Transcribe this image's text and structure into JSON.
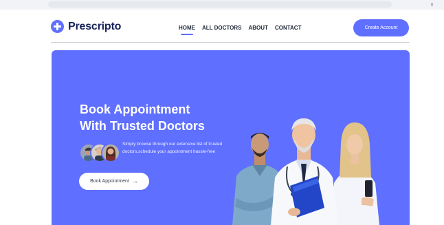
{
  "brand": {
    "name": "Prescripto",
    "logo_icon": "medical-cross-icon"
  },
  "nav": {
    "links": [
      "HOME",
      "ALL DOCTORS",
      "ABOUT",
      "CONTACT"
    ],
    "active": "HOME"
  },
  "header": {
    "cta_label": "Create Account"
  },
  "hero": {
    "title_line1": "Book Appointment",
    "title_line2": "With Trusted Doctors",
    "description": "Simply browse through our extensive list of trusted doctors,schedule your appointment hassle-free",
    "button_label": "Book Appointment",
    "button_icon": "arrow-right-icon"
  },
  "colors": {
    "primary": "#5f6fff",
    "logo_text": "#16225a",
    "white": "#ffffff"
  }
}
